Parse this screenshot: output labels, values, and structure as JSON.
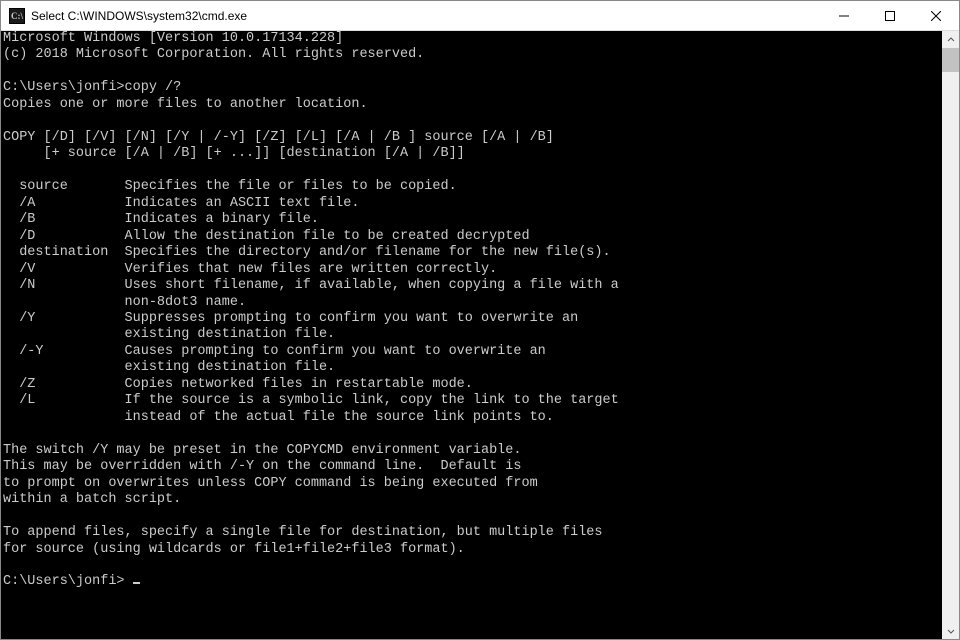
{
  "titlebar": {
    "title": "Select C:\\WINDOWS\\system32\\cmd.exe"
  },
  "terminal": {
    "line_version": "Microsoft Windows [Version 10.0.17134.228]",
    "line_copyright": "(c) 2018 Microsoft Corporation. All rights reserved.",
    "prompt1_prefix": "C:\\Users\\jonfi>",
    "prompt1_cmd": "copy /?",
    "help_intro": "Copies one or more files to another location.",
    "syntax1": "COPY [/D] [/V] [/N] [/Y | /-Y] [/Z] [/L] [/A | /B ] source [/A | /B]",
    "syntax2": "     [+ source [/A | /B] [+ ...]] [destination [/A | /B]]",
    "opt_source": "  source       Specifies the file or files to be copied.",
    "opt_a": "  /A           Indicates an ASCII text file.",
    "opt_b": "  /B           Indicates a binary file.",
    "opt_d": "  /D           Allow the destination file to be created decrypted",
    "opt_dest": "  destination  Specifies the directory and/or filename for the new file(s).",
    "opt_v": "  /V           Verifies that new files are written correctly.",
    "opt_n": "  /N           Uses short filename, if available, when copying a file with a",
    "opt_n2": "               non-8dot3 name.",
    "opt_y": "  /Y           Suppresses prompting to confirm you want to overwrite an",
    "opt_y2": "               existing destination file.",
    "opt_yy": "  /-Y          Causes prompting to confirm you want to overwrite an",
    "opt_yy2": "               existing destination file.",
    "opt_z": "  /Z           Copies networked files in restartable mode.",
    "opt_l": "  /L           If the source is a symbolic link, copy the link to the target",
    "opt_l2": "               instead of the actual file the source link points to.",
    "note1": "The switch /Y may be preset in the COPYCMD environment variable.",
    "note2": "This may be overridden with /-Y on the command line.  Default is",
    "note3": "to prompt on overwrites unless COPY command is being executed from",
    "note4": "within a batch script.",
    "note5": "To append files, specify a single file for destination, but multiple files",
    "note6": "for source (using wildcards or file1+file2+file3 format).",
    "prompt2_prefix": "C:\\Users\\jonfi> "
  }
}
